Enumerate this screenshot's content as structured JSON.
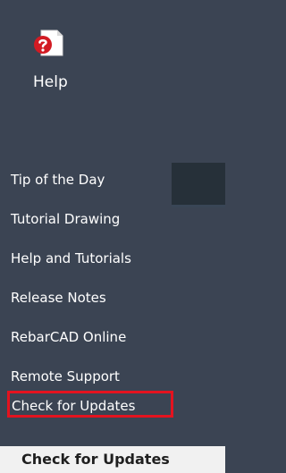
{
  "ribbon": {
    "help_button": {
      "label": "Help",
      "icon": "help-question-icon"
    }
  },
  "menu": {
    "items": [
      {
        "label": "Tip of the Day"
      },
      {
        "label": "Tutorial Drawing"
      },
      {
        "label": "Help and Tutorials"
      },
      {
        "label": "Release Notes"
      },
      {
        "label": "RebarCAD Online"
      },
      {
        "label": "Remote Support"
      },
      {
        "label": "Check for Updates"
      }
    ],
    "highlight_color": "#e4131f"
  },
  "footer": {
    "label": "Check for Updates"
  },
  "colors": {
    "ribbon_background": "#3b4453",
    "footer_background": "#f1f1f1",
    "help_icon_red": "#d21b23"
  }
}
